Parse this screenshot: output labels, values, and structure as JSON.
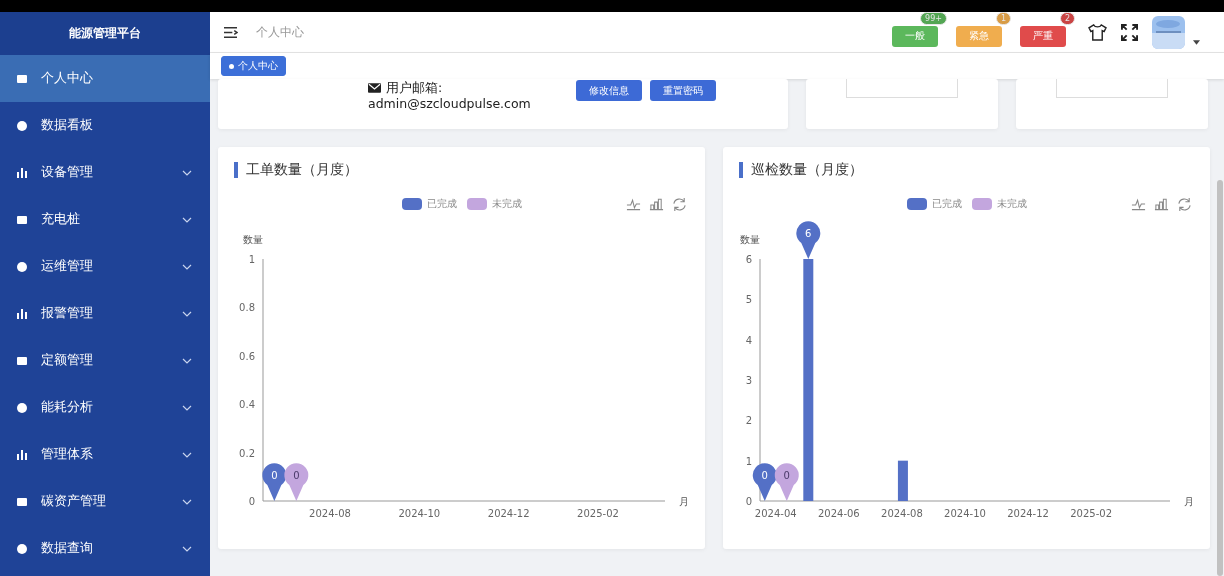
{
  "sidebar": {
    "title": "能源管理平台",
    "items": [
      {
        "label": "个人中心",
        "selected": true,
        "has_submenu": false
      },
      {
        "label": "数据看板",
        "selected": false,
        "has_submenu": false
      },
      {
        "label": "设备管理",
        "selected": false,
        "has_submenu": true
      },
      {
        "label": "充电桩",
        "selected": false,
        "has_submenu": true
      },
      {
        "label": "运维管理",
        "selected": false,
        "has_submenu": true
      },
      {
        "label": "报警管理",
        "selected": false,
        "has_submenu": true
      },
      {
        "label": "定额管理",
        "selected": false,
        "has_submenu": true
      },
      {
        "label": "能耗分析",
        "selected": false,
        "has_submenu": true
      },
      {
        "label": "管理体系",
        "selected": false,
        "has_submenu": true
      },
      {
        "label": "碳资产管理",
        "selected": false,
        "has_submenu": true
      },
      {
        "label": "数据查询",
        "selected": false,
        "has_submenu": true
      }
    ]
  },
  "header": {
    "breadcrumb": "个人中心",
    "alerts": [
      {
        "label": "一般",
        "count": "99+",
        "color": "#5cb85c"
      },
      {
        "label": "紧急",
        "count": "1",
        "color": "#f0ad4e"
      },
      {
        "label": "严重",
        "count": "2",
        "color": "#e04b4b"
      }
    ]
  },
  "tags": [
    {
      "label": "个人中心",
      "selected": true
    }
  ],
  "profile": {
    "email_label": "用户邮箱:",
    "email": "admin@szcloudpulse.com",
    "buttons": [
      "修改信息",
      "重置密码"
    ]
  },
  "charts": [
    {
      "title": "工单数量（月度）",
      "chart_data": {
        "type": "bar",
        "xlabel": "月",
        "ylabel": "数量",
        "categories": [
          null,
          "2024-08",
          null,
          "2024-10",
          null,
          "2024-12",
          null,
          "2025-02",
          null
        ],
        "ylim": [
          0,
          1
        ],
        "yticks": [
          0,
          0.2,
          0.4,
          0.6,
          0.8,
          1
        ],
        "series": [
          {
            "name": "已完成",
            "color": "#5470c6",
            "values": [
              0,
              0,
              0,
              0,
              0,
              0,
              0,
              0,
              0
            ]
          },
          {
            "name": "未完成",
            "color": "#c3a6de",
            "values": [
              0,
              0,
              0,
              0,
              0,
              0,
              0,
              0,
              0
            ]
          }
        ]
      },
      "series_pins": [
        [
          {
            "kind": "min",
            "label": "0"
          }
        ],
        [
          {
            "kind": "min",
            "label": "0"
          }
        ]
      ]
    },
    {
      "title": "巡检数量（月度）",
      "chart_data": {
        "type": "bar",
        "xlabel": "月",
        "ylabel": "数量",
        "categories": [
          "2024-04",
          null,
          "2024-06",
          null,
          "2024-08",
          null,
          "2024-10",
          null,
          "2024-12",
          null,
          "2025-02",
          null,
          null
        ],
        "ylim": [
          0,
          6
        ],
        "yticks": [
          0,
          1,
          2,
          3,
          4,
          5,
          6
        ],
        "series": [
          {
            "name": "已完成",
            "color": "#5470c6",
            "values": [
              0,
              6,
              0,
              0,
              1,
              0,
              0,
              0,
              0,
              0,
              0,
              0,
              0
            ]
          },
          {
            "name": "未完成",
            "color": "#c3a6de",
            "values": [
              0,
              0,
              0,
              0,
              0,
              0,
              0,
              0,
              0,
              0,
              0,
              0,
              0
            ]
          }
        ]
      },
      "series_pins": [
        [
          {
            "kind": "min",
            "label": "0"
          },
          {
            "kind": "max",
            "label": "6"
          }
        ],
        [
          {
            "kind": "min",
            "label": "0"
          }
        ]
      ]
    }
  ]
}
